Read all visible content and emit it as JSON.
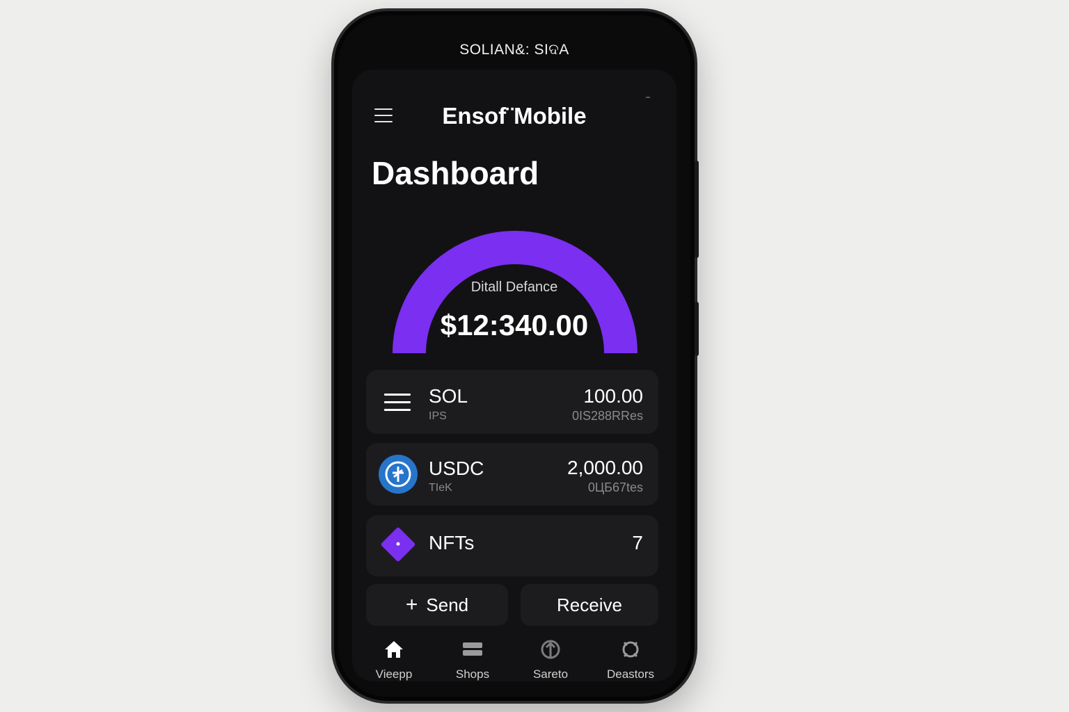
{
  "status_bar": {
    "text": "SOLIAN&: SIଦA"
  },
  "header": {
    "title": "Ensof¨Mobile",
    "menu_icon": "hamburger-icon"
  },
  "page": {
    "title": "Dashboard"
  },
  "balance": {
    "label": "Ditall Defance",
    "value": "$12:340.00",
    "gauge_color": "#7b2ff0",
    "gauge_fraction": 1.0
  },
  "assets": [
    {
      "name": "SOL",
      "sub": "IPS",
      "amount": "100.00",
      "usd": "0IS288RRes",
      "icon": "solana-icon"
    },
    {
      "name": "USDC",
      "sub": "TIeK",
      "amount": "2,000.00",
      "usd": "0ЦБ67tes",
      "icon": "usdc-icon",
      "icon_color": "#2775ca"
    },
    {
      "name": "NFTs",
      "amount": "7",
      "icon": "nft-diamond-icon",
      "icon_color": "#7b2ff0"
    }
  ],
  "actions": {
    "send": "Send",
    "receive": "Receive"
  },
  "tabs": [
    {
      "label": "Vieepp",
      "icon": "home-icon"
    },
    {
      "label": "Shops",
      "icon": "wallet-icon"
    },
    {
      "label": "Sareto",
      "icon": "swap-icon"
    },
    {
      "label": "Deastors",
      "icon": "settings-icon"
    }
  ],
  "colors": {
    "background": "#eeeeed",
    "screen": "#121214",
    "card": "#1c1c1e",
    "accent": "#7b2ff0"
  }
}
